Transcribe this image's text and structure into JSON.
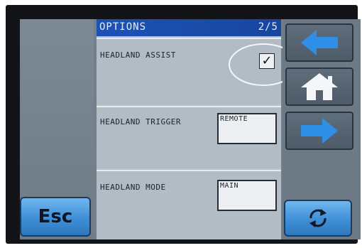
{
  "header": {
    "title": "OPTIONS",
    "page": "2/5"
  },
  "options": [
    {
      "label": "HEADLAND ASSIST",
      "checked": true,
      "check_glyph": "✓"
    },
    {
      "label": "HEADLAND TRIGGER",
      "value": "REMOTE"
    },
    {
      "label": "HEADLAND MODE",
      "value": "MAIN"
    }
  ],
  "buttons": {
    "esc_label": "Esc"
  },
  "icons": {
    "back": "arrow-left-icon",
    "home": "home-icon",
    "next": "arrow-right-icon",
    "refresh": "refresh-icon"
  },
  "colors": {
    "accent": "#1d52b5",
    "button_blue": "#3f8fd6",
    "arrow_blue": "#2f8fe6",
    "panel": "#b2bcc5"
  }
}
